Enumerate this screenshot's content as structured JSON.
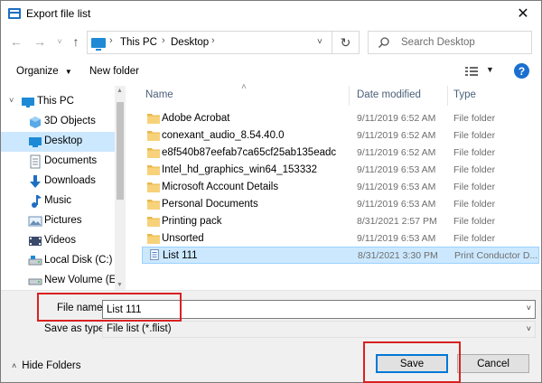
{
  "window": {
    "title": "Export file list",
    "close_glyph": "✕"
  },
  "nav": {
    "breadcrumb": [
      "This PC",
      "Desktop"
    ],
    "search_placeholder": "Search Desktop"
  },
  "toolbar": {
    "organize_label": "Organize",
    "new_folder_label": "New folder",
    "help_label": "?"
  },
  "sidebar": {
    "items": [
      {
        "label": "This PC",
        "icon": "computer-icon",
        "chevron": "˅"
      },
      {
        "label": "3D Objects",
        "icon": "3d-objects-icon",
        "chevron": "›"
      },
      {
        "label": "Desktop",
        "icon": "desktop-icon",
        "chevron": "›",
        "selected": true
      },
      {
        "label": "Documents",
        "icon": "documents-icon",
        "chevron": "›"
      },
      {
        "label": "Downloads",
        "icon": "downloads-icon",
        "chevron": "›"
      },
      {
        "label": "Music",
        "icon": "music-icon",
        "chevron": "›"
      },
      {
        "label": "Pictures",
        "icon": "pictures-icon",
        "chevron": "›"
      },
      {
        "label": "Videos",
        "icon": "videos-icon",
        "chevron": "›"
      },
      {
        "label": "Local Disk (C:)",
        "icon": "drive-icon",
        "chevron": "›"
      },
      {
        "label": "New Volume (E:)",
        "icon": "drive-icon",
        "chevron": "›"
      }
    ]
  },
  "filelist": {
    "columns": {
      "name": "Name",
      "date": "Date modified",
      "type": "Type"
    },
    "rows": [
      {
        "name": "Adobe Acrobat",
        "date": "9/11/2019 6:52 AM",
        "type": "File folder",
        "icon": "folder-icon"
      },
      {
        "name": "conexant_audio_8.54.40.0",
        "date": "9/11/2019 6:52 AM",
        "type": "File folder",
        "icon": "folder-icon"
      },
      {
        "name": "e8f540b87eefab7ca65cf25ab135eadc",
        "date": "9/11/2019 6:52 AM",
        "type": "File folder",
        "icon": "folder-icon"
      },
      {
        "name": "Intel_hd_graphics_win64_153332",
        "date": "9/11/2019 6:53 AM",
        "type": "File folder",
        "icon": "folder-icon"
      },
      {
        "name": "Microsoft Account Details",
        "date": "9/11/2019 6:53 AM",
        "type": "File folder",
        "icon": "folder-icon"
      },
      {
        "name": "Personal Documents",
        "date": "9/11/2019 6:53 AM",
        "type": "File folder",
        "icon": "folder-icon"
      },
      {
        "name": "Printing pack",
        "date": "8/31/2021 2:57 PM",
        "type": "File folder",
        "icon": "folder-icon"
      },
      {
        "name": "Unsorted",
        "date": "9/11/2019 6:53 AM",
        "type": "File folder",
        "icon": "folder-icon"
      },
      {
        "name": "List 111",
        "date": "8/31/2021 3:30 PM",
        "type": "Print Conductor D...",
        "icon": "list-file-icon",
        "selected": true
      }
    ]
  },
  "bottom": {
    "file_name_label": "File name:",
    "file_name_value": "List 111",
    "save_type_label": "Save as type:",
    "save_type_value": "File list (*.flist)",
    "hide_folders_label": "Hide Folders",
    "save_label": "Save",
    "cancel_label": "Cancel"
  },
  "colors": {
    "selection": "#cce8ff",
    "highlight_box": "#d92121",
    "accent": "#0078d7",
    "folder": "#e8b84a"
  }
}
